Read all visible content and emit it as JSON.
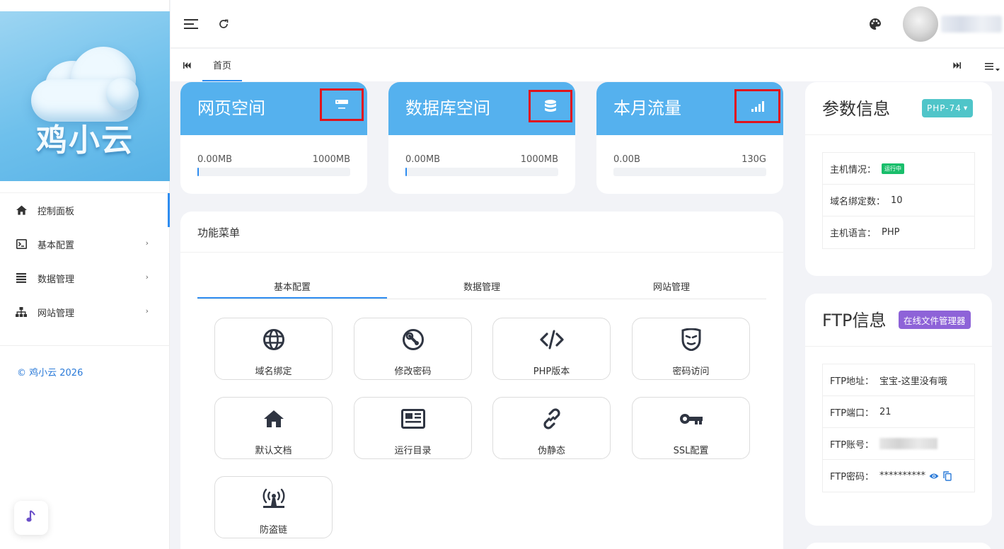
{
  "brand": {
    "logo_text": "鸡小云",
    "copyright": "© 鸡小云 2026"
  },
  "sidebar": {
    "items": [
      {
        "label": "控制面板",
        "icon": "home-icon",
        "active": true,
        "has_children": false
      },
      {
        "label": "基本配置",
        "icon": "terminal-icon",
        "has_children": true
      },
      {
        "label": "数据管理",
        "icon": "list-icon",
        "has_children": true
      },
      {
        "label": "网站管理",
        "icon": "sitemap-icon",
        "has_children": true
      }
    ],
    "chevron": "›"
  },
  "tabs": {
    "home_label": "首页"
  },
  "stats": [
    {
      "title": "网页空间",
      "used": "0.00MB",
      "total": "1000MB",
      "icon": "server-icon",
      "progress": 0.01
    },
    {
      "title": "数据库空间",
      "used": "0.00MB",
      "total": "1000MB",
      "icon": "database-icon",
      "progress": 0.01
    },
    {
      "title": "本月流量",
      "used": "0.00B",
      "total": "130G",
      "icon": "signal-icon",
      "progress": 0.01
    }
  ],
  "functions": {
    "title": "功能菜单",
    "tabs": [
      "基本配置",
      "数据管理",
      "网站管理"
    ],
    "active_tab": 0,
    "buttons": [
      {
        "label": "域名绑定",
        "icon": "globe-icon"
      },
      {
        "label": "修改密码",
        "icon": "wrench-icon"
      },
      {
        "label": "PHP版本",
        "icon": "code-icon"
      },
      {
        "label": "密码访问",
        "icon": "mask-icon"
      },
      {
        "label": "默认文档",
        "icon": "house-icon"
      },
      {
        "label": "运行目录",
        "icon": "newspaper-icon"
      },
      {
        "label": "伪静态",
        "icon": "link-icon"
      },
      {
        "label": "SSL配置",
        "icon": "key-icon"
      },
      {
        "label": "防盗链",
        "icon": "antenna-icon"
      }
    ]
  },
  "params": {
    "title": "参数信息",
    "php_badge": "PHP-74",
    "rows": [
      {
        "key": "主机情况：",
        "value": "运行中"
      },
      {
        "key": "域名绑定数：",
        "value": "10"
      },
      {
        "key": "主机语言：",
        "value": "PHP"
      }
    ]
  },
  "ftp": {
    "title": "FTP信息",
    "manager_badge": "在线文件管理器",
    "rows": [
      {
        "key": "FTP地址：",
        "value": "宝宝-这里没有哦"
      },
      {
        "key": "FTP端口：",
        "value": "21"
      },
      {
        "key": "FTP账号：",
        "value": ""
      },
      {
        "key": "FTP密码：",
        "value": "**********"
      }
    ]
  },
  "colors": {
    "accent": "#2d8cf0",
    "stat_header": "#55b1ee",
    "php_badge": "#4fc5c9",
    "ftp_badge": "#8e63d8",
    "status_green": "#19be6b",
    "highlight_box": "#e0141c"
  }
}
